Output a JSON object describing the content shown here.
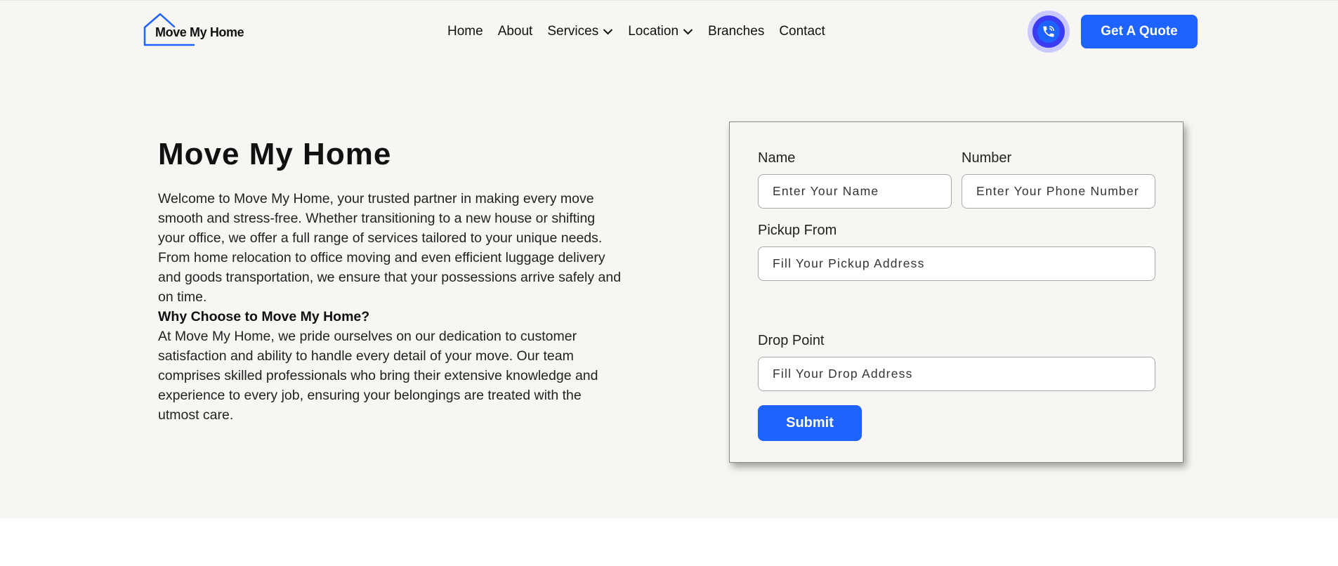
{
  "header": {
    "brand": "Move My Home",
    "nav": [
      {
        "label": "Home"
      },
      {
        "label": "About"
      },
      {
        "label": "Services"
      },
      {
        "label": "Location"
      },
      {
        "label": "Branches"
      },
      {
        "label": "Contact"
      }
    ],
    "call_icon": "phone-call-icon",
    "quote_label": "Get A Quote"
  },
  "hero": {
    "title": "Move My Home",
    "intro": "Welcome to Move My Home, your trusted partner in making every move smooth and stress-free. Whether transitioning to a new house or shifting your office, we offer a full range of services tailored to your unique needs. From home relocation to office moving and even efficient luggage delivery and goods transportation, we ensure that your possessions arrive safely and on time.",
    "why_heading": "Why Choose to Move My Home?",
    "why_text": "At Move My Home, we pride ourselves on our dedication to customer satisfaction and ability to handle every detail of your move. Our team comprises skilled professionals who bring their extensive knowledge and experience to every job, ensuring your belongings are treated with the utmost care."
  },
  "form": {
    "name_label": "Name",
    "name_placeholder": "Enter Your Name",
    "number_label": "Number",
    "number_placeholder": "Enter Your Phone Number",
    "pickup_label": "Pickup From",
    "pickup_placeholder": "Fill Your Pickup Address",
    "drop_label": "Drop Point",
    "drop_placeholder": "Fill Your Drop Address",
    "submit_label": "Submit"
  },
  "colors": {
    "accent": "#1e62ff",
    "hero_bg": "#f8f6f3",
    "call_ring": "#c9c8ff"
  }
}
